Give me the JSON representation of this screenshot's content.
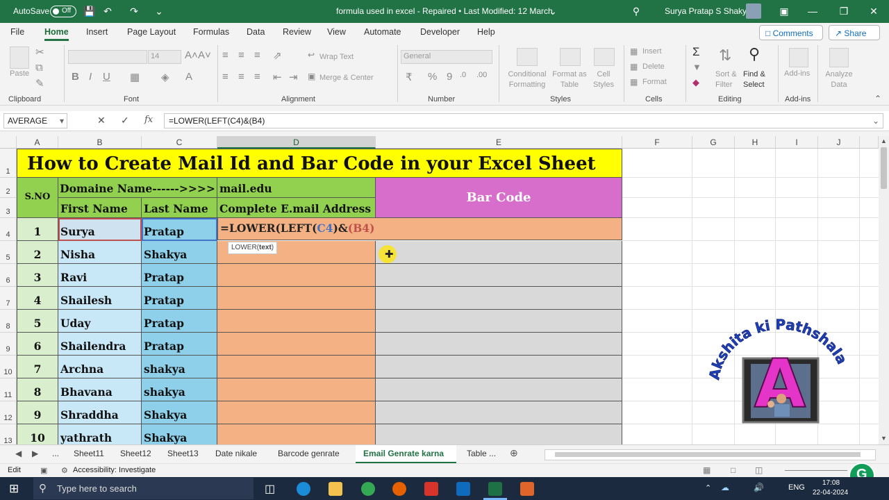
{
  "titlebar": {
    "autosave_label": "AutoSave",
    "autosave_state": "Off",
    "doc_title": "formula used in excel  -  Repaired  •  Last Modified: 12 March",
    "user_name": "Surya Pratap S Shakya",
    "accent": "#217346"
  },
  "menu": {
    "tabs": [
      "File",
      "Home",
      "Insert",
      "Page Layout",
      "Formulas",
      "Data",
      "Review",
      "View",
      "Automate",
      "Developer",
      "Help"
    ],
    "active": "Home",
    "comments_label": "Comments",
    "share_label": "Share"
  },
  "ribbon": {
    "groups": {
      "clipboard": "Clipboard",
      "font": "Font",
      "alignment": "Alignment",
      "number": "Number",
      "styles": "Styles",
      "cells": "Cells",
      "editing": "Editing",
      "addins": "Add-ins"
    },
    "paste": "Paste",
    "font_size": "14",
    "wrap_text": "Wrap Text",
    "merge_center": "Merge & Center",
    "number_format": "General",
    "conditional_formatting": "Conditional Formatting",
    "format_as_table": "Format as Table",
    "cell_styles": "Cell Styles",
    "insert": "Insert",
    "delete": "Delete",
    "format": "Format",
    "sort_filter": "Sort & Filter",
    "find_select": "Find & Select",
    "addins_btn": "Add-ins",
    "analyze_data": "Analyze Data"
  },
  "formula_bar": {
    "name_box": "AVERAGE",
    "fx": "fx",
    "formula": "=LOWER(LEFT(C4)&(B4)"
  },
  "columns": [
    "A",
    "B",
    "C",
    "D",
    "E",
    "F",
    "G",
    "H",
    "I",
    "J"
  ],
  "rows": [
    "1",
    "2",
    "3",
    "4",
    "5",
    "6",
    "7",
    "8",
    "9",
    "10",
    "11",
    "12",
    "13"
  ],
  "sheet": {
    "title": "How to Create Mail Id  and Bar Code in your Excel Sheet",
    "sno_header": "S.NO",
    "domain_label": "Domaine Name------>>>>",
    "domain_value": "mail.edu",
    "bar_code_header": "Bar Code",
    "first_name_header": "First Name",
    "last_name_header": "Last Name",
    "email_header": "Complete E.mail Address",
    "editing_formula_parts": [
      "=LOWER(LEFT(",
      "C4",
      ")&",
      "(B4)"
    ],
    "tooltip_fn": "LOWER(",
    "tooltip_arg": "text",
    "tooltip_end": ")",
    "records": [
      {
        "sno": "1",
        "first": "Surya",
        "last": "Pratap"
      },
      {
        "sno": "2",
        "first": "Nisha",
        "last": "Shakya"
      },
      {
        "sno": "3",
        "first": "Ravi",
        "last": "Pratap"
      },
      {
        "sno": "4",
        "first": "Shailesh",
        "last": "Pratap"
      },
      {
        "sno": "5",
        "first": "Uday",
        "last": "Pratap"
      },
      {
        "sno": "6",
        "first": "Shailendra",
        "last": "Pratap"
      },
      {
        "sno": "7",
        "first": "Archna",
        "last": "shakya"
      },
      {
        "sno": "8",
        "first": "Bhavana",
        "last": "shakya"
      },
      {
        "sno": "9",
        "first": "Shraddha",
        "last": "Shakya"
      },
      {
        "sno": "10",
        "first": "yathrath",
        "last": "Shakya"
      }
    ],
    "colors": {
      "title_bg": "#ffff00",
      "sno_bg": "#92d050",
      "sno_data_bg": "#d8eecd",
      "first_bg": "#c9e8f7",
      "last_bg": "#8ecfe9",
      "email_bg": "#f4b183",
      "barcode_header_bg": "#d86ecc",
      "barcode_bg": "#d9d9d9"
    }
  },
  "logo": {
    "text": "Akshita ki Pathshala",
    "letter": "A"
  },
  "sheet_tabs": [
    "...",
    "Sheet11",
    "Sheet12",
    "Sheet13",
    "Date nikale",
    "Barcode  genrate",
    "Email  Genrate karna",
    "Table  ..."
  ],
  "active_sheet_tab": "Email  Genrate karna",
  "status": {
    "mode": "Edit",
    "accessibility": "Accessibility: Investigate"
  },
  "taskbar": {
    "search_placeholder": "Type here to search",
    "lang": "ENG",
    "time": "17:08",
    "date": "22-04-2024"
  }
}
